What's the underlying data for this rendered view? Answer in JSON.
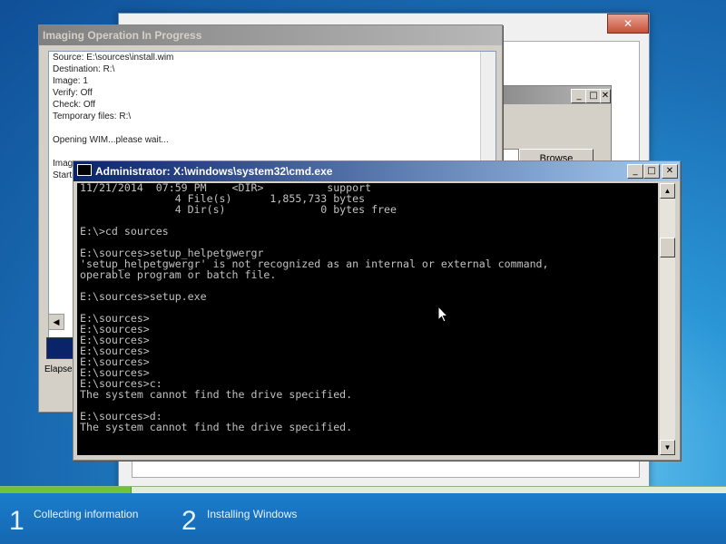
{
  "setup_window": {
    "close_label": "✕",
    "browse_label": "Browse"
  },
  "imaging_window": {
    "title": "Imaging Operation In Progress",
    "lines": [
      "Source: E:\\sources\\install.wim",
      "Destination: R:\\",
      "Image: 1",
      "Verify: Off",
      "Check: Off",
      "Temporary files: R:\\",
      "",
      "Opening WIM...please wait...",
      "",
      "Image",
      "Starti"
    ],
    "elapsed_label": "Elapse"
  },
  "cmd_window": {
    "title": "Administrator: X:\\windows\\system32\\cmd.exe",
    "lines": [
      "11/21/2014  07:59 PM    <DIR>          support",
      "               4 File(s)      1,855,733 bytes",
      "               4 Dir(s)               0 bytes free",
      "",
      "E:\\>cd sources",
      "",
      "E:\\sources>setup_helpetgwergr",
      "'setup_helpetgwergr' is not recognized as an internal or external command,",
      "operable program or batch file.",
      "",
      "E:\\sources>setup.exe",
      "",
      "E:\\sources>",
      "E:\\sources>",
      "E:\\sources>",
      "E:\\sources>",
      "E:\\sources>",
      "E:\\sources>",
      "E:\\sources>c:",
      "The system cannot find the drive specified.",
      "",
      "E:\\sources>d:",
      "The system cannot find the drive specified."
    ],
    "controls": {
      "minimize": "_",
      "maximize": "□",
      "close": "✕"
    }
  },
  "progress": {
    "fraction": 0.18
  },
  "steps": [
    {
      "number": "1",
      "label": "Collecting information"
    },
    {
      "number": "2",
      "label": "Installing Windows"
    }
  ]
}
